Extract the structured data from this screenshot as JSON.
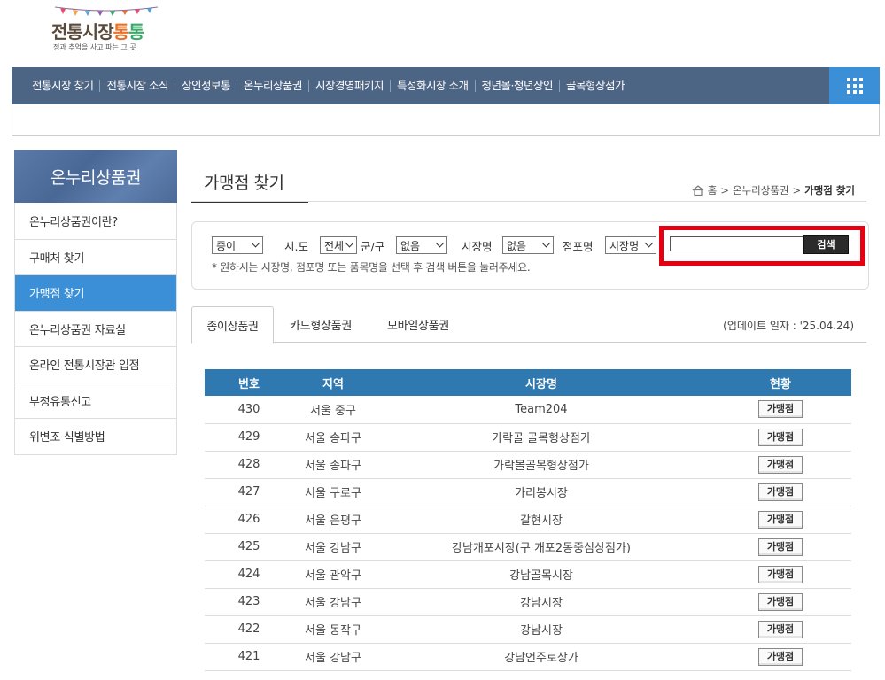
{
  "logo": {
    "main_a": "전통시장",
    "main_b": "통",
    "main_c": "통",
    "tagline": "정과 추억을 사고 파는 그 곳"
  },
  "nav": {
    "items": [
      "전통시장 찾기",
      "전통시장 소식",
      "상인정보통",
      "온누리상품권",
      "시장경영패키지",
      "특성화시장 소개",
      "청년몰·청년상인",
      "골목형상점가"
    ]
  },
  "sidebar": {
    "title": "온누리상품권",
    "items": [
      {
        "label": "온누리상품권이란?",
        "active": false
      },
      {
        "label": "구매처 찾기",
        "active": false
      },
      {
        "label": "가맹점 찾기",
        "active": true
      },
      {
        "label": "온누리상품권 자료실",
        "active": false
      },
      {
        "label": "온라인 전통시장관 입점",
        "active": false
      },
      {
        "label": "부정유통신고",
        "active": false
      },
      {
        "label": "위변조 식별방법",
        "active": false
      }
    ]
  },
  "page": {
    "title": "가맹점 찾기",
    "breadcrumb": {
      "home": "홈",
      "level1": "온누리상품권",
      "current": "가맹점 찾기"
    }
  },
  "search": {
    "type_select": "종이",
    "sido_label": "시.도",
    "sido_select": "전체",
    "gungu_label": "군/구",
    "gungu_select": "없음",
    "market_label": "시장명",
    "market_select": "없음",
    "store_label": "점포명",
    "keyword_type_select": "시장명",
    "keyword_value": "",
    "button": "검색",
    "hint": "* 원하시는 시장명, 점포명 또는 품목명을 선택 후 검색 버튼을 눌러주세요."
  },
  "tabs": {
    "items": [
      "종이상품권",
      "카드형상품권",
      "모바일상품권"
    ],
    "update": "(업데이트 일자 : '25.04.24)"
  },
  "table": {
    "headers": [
      "번호",
      "지역",
      "시장명",
      "현황"
    ],
    "button_label": "가맹점",
    "rows": [
      {
        "no": "430",
        "region": "서울 중구",
        "market": "Team204"
      },
      {
        "no": "429",
        "region": "서울 송파구",
        "market": "가락골 골목형상점가"
      },
      {
        "no": "428",
        "region": "서울 송파구",
        "market": "가락몰골목형상점가"
      },
      {
        "no": "427",
        "region": "서울 구로구",
        "market": "가리봉시장"
      },
      {
        "no": "426",
        "region": "서울 은평구",
        "market": "갈현시장"
      },
      {
        "no": "425",
        "region": "서울 강남구",
        "market": "강남개포시장(구 개포2동중심상점가)"
      },
      {
        "no": "424",
        "region": "서울 관악구",
        "market": "강남골목시장"
      },
      {
        "no": "423",
        "region": "서울 강남구",
        "market": "강남시장"
      },
      {
        "no": "422",
        "region": "서울 동작구",
        "market": "강남시장"
      },
      {
        "no": "421",
        "region": "서울 강남구",
        "market": "강남언주로상가"
      }
    ]
  },
  "colors": {
    "nav_bg": "#4d6585",
    "accent": "#3a8fd6",
    "table_head": "#2f78b0",
    "highlight": "#e60012"
  }
}
